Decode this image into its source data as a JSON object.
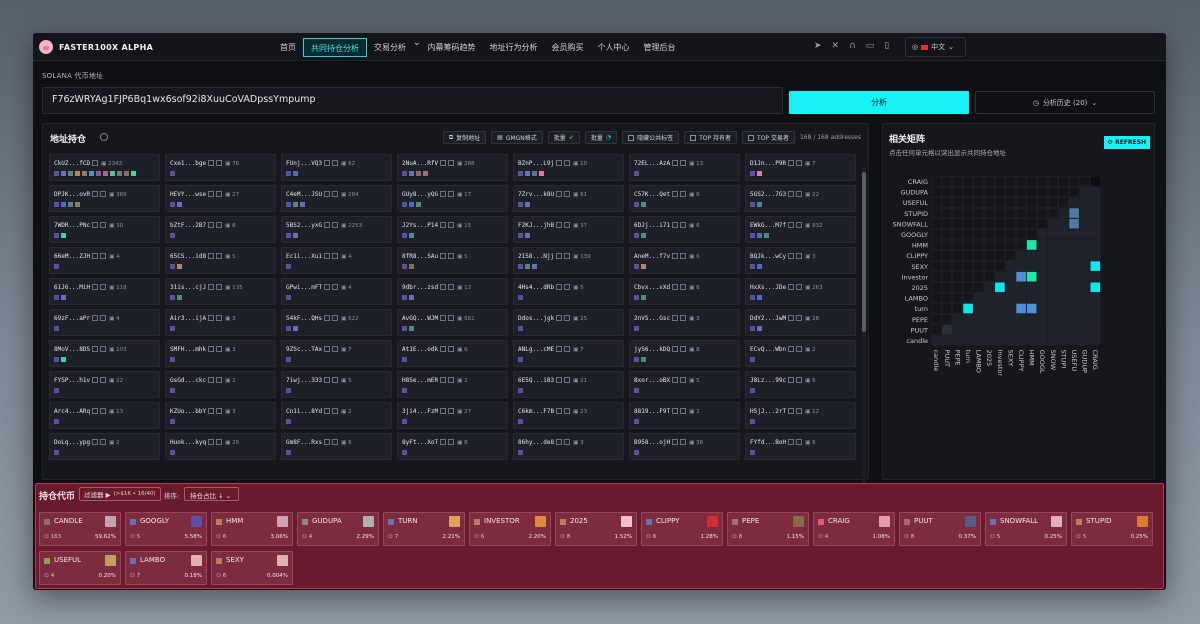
{
  "app": {
    "name": "FASTER100X ALPHA"
  },
  "nav": [
    "首页",
    "共同持仓分析",
    "交易分析",
    "内幕筹码趋势",
    "地址行为分析",
    "会员购买",
    "个人中心",
    "管理后台"
  ],
  "nav_dropdown_index": 2,
  "lang": "中文",
  "address_label": "SOLANA 代币地址",
  "address_value": "F76zWRYAg1FJP6Bq1wx6sof92i8XuuCoVADpssYmpump",
  "analyze_label": "分析",
  "history_label": "分析历史 (20)",
  "holdings": {
    "title": "地址持仓",
    "copy": "复制地址",
    "gmgn": "GMGN格式",
    "batch1": "批量",
    "batch2": "批量",
    "hide_public": "隐藏公共标签",
    "top_holder": "TOP 持有者",
    "top_trader": "TOP 交易者",
    "count": "168 / 168 addresses",
    "cards": [
      {
        "a": "CkUZ...fCD",
        "t": "T",
        "n": "2343",
        "c": [
          "#5a4ea8",
          "#6b6fb5",
          "#4f8a84",
          "#b08a5e",
          "#8a7a6a",
          "#5a8fc0",
          "#8a5a9c",
          "#a86a7a",
          "#4ac88a",
          "#6c7a8a",
          "#8a6a5a",
          "#3ed6a0"
        ]
      },
      {
        "a": "Cxe1...bge",
        "t": "HT",
        "n": "76",
        "c": [
          "#5a4ea8"
        ]
      },
      {
        "a": "FUnj...VQ3",
        "t": "HT",
        "n": "62",
        "c": [
          "#5a4ea8",
          "#4a6fb5"
        ]
      },
      {
        "a": "2NuA...RfV",
        "t": "HT",
        "n": "288",
        "c": [
          "#5a4ea8",
          "#6b6fb5",
          "#8a6a5a",
          "#a86a7a"
        ]
      },
      {
        "a": "BZnP...L9j",
        "t": "HT",
        "n": "10",
        "c": [
          "#5a4ea8",
          "#6b6fb5",
          "#4f7a84",
          "#e07aa0"
        ]
      },
      {
        "a": "72EL...AzA",
        "t": "HT",
        "n": "13",
        "c": [
          "#5a4ea8"
        ]
      },
      {
        "a": "D1Jn...P9R",
        "t": "HT",
        "n": "7",
        "c": [
          "#5a4ea8",
          "#e07aa0"
        ]
      },
      {
        "a": "DPJK...ovR",
        "t": "HT",
        "n": "369",
        "c": [
          "#5a4ea8",
          "#4a6fb5",
          "#4f8a84",
          "#8a7a6a"
        ]
      },
      {
        "a": "HEVY...wse",
        "t": "HT",
        "n": "27",
        "c": [
          "#5a4ea8",
          "#6b6fb5"
        ]
      },
      {
        "a": "C4eM...JSU",
        "t": "HT",
        "n": "284",
        "c": [
          "#5a4ea8",
          "#4f8a84",
          "#6b6fb5"
        ]
      },
      {
        "a": "GUy8...yQG",
        "t": "HT",
        "n": "17",
        "c": [
          "#5a4ea8",
          "#4a6fb5",
          "#4f8a84"
        ]
      },
      {
        "a": "7Zrv...k8U",
        "t": "HT",
        "n": "61",
        "c": [
          "#5a4ea8",
          "#6b6fb5"
        ]
      },
      {
        "a": "C57K...Qet",
        "t": "HT",
        "n": "6",
        "c": [
          "#5a4ea8",
          "#4f8a84"
        ]
      },
      {
        "a": "5GS2...7G3",
        "t": "HT",
        "n": "22",
        "c": [
          "#5a4ea8",
          "#4f8a84"
        ]
      },
      {
        "a": "7WDR...PNc",
        "t": "HT",
        "n": "30",
        "c": [
          "#5a4ea8",
          "#3ed6a0"
        ]
      },
      {
        "a": "bZtF...2B7",
        "t": "HT",
        "n": "8",
        "c": [
          "#5a4ea8"
        ]
      },
      {
        "a": "5BS2...yxG",
        "t": "HT",
        "n": "2253",
        "c": [
          "#5a4ea8",
          "#6b6fb5"
        ]
      },
      {
        "a": "J2Ys...P14",
        "t": "HT",
        "n": "15",
        "c": [
          "#5a4ea8",
          "#4f8a84"
        ]
      },
      {
        "a": "F2KJ...jhB",
        "t": "HT",
        "n": "37",
        "c": [
          "#5a4ea8",
          "#6b6fb5"
        ]
      },
      {
        "a": "6DJj...i71",
        "t": "HT",
        "n": "6",
        "c": [
          "#5a4ea8",
          "#4f8a84"
        ]
      },
      {
        "a": "EWkG...M7f",
        "t": "HT",
        "n": "832",
        "c": [
          "#5a4ea8",
          "#4a6fb5",
          "#4f8a84"
        ]
      },
      {
        "a": "66eM...ZJH",
        "t": "HT",
        "n": "4",
        "c": [
          "#5a4ea8"
        ]
      },
      {
        "a": "65CS...id8",
        "t": "HT",
        "n": "5",
        "c": [
          "#5a4ea8",
          "#b08a5e"
        ]
      },
      {
        "a": "Ec1i...Xu1",
        "t": "HT",
        "n": "4",
        "c": [
          "#5a4ea8"
        ]
      },
      {
        "a": "8fR8...SAu",
        "t": "HT",
        "n": "5",
        "c": [
          "#5a4ea8",
          "#8a6a5a"
        ]
      },
      {
        "a": "2158...Njj",
        "t": "HT",
        "n": "139",
        "c": [
          "#5a4ea8",
          "#4f8a84",
          "#6b6fb5"
        ]
      },
      {
        "a": "AneM...f7v",
        "t": "HT",
        "n": "6",
        "c": [
          "#5a4ea8",
          "#b08a5e"
        ]
      },
      {
        "a": "BQJk...wCy",
        "t": "HT",
        "n": "3",
        "c": [
          "#5a4ea8",
          "#4a6fb5"
        ]
      },
      {
        "a": "61J6...MiH",
        "t": "HT",
        "n": "118",
        "c": [
          "#5a4ea8",
          "#6b6fb5"
        ]
      },
      {
        "a": "31is...cjJ",
        "t": "HT",
        "n": "135",
        "c": [
          "#5a4ea8",
          "#4f8a84"
        ]
      },
      {
        "a": "GPwi...mFT",
        "t": "HT",
        "n": "4",
        "c": [
          "#5a4ea8"
        ]
      },
      {
        "a": "9dbr...zsd",
        "t": "HT",
        "n": "12",
        "c": [
          "#5a4ea8",
          "#6b6fb5"
        ]
      },
      {
        "a": "4Hs4...dRb",
        "t": "HT",
        "n": "5",
        "c": [
          "#5a4ea8"
        ]
      },
      {
        "a": "Cbvx...vXd",
        "t": "HT",
        "n": "6",
        "c": [
          "#5a4ea8",
          "#4f8a84"
        ]
      },
      {
        "a": "HxXs...JDe",
        "t": "HT",
        "n": "263",
        "c": [
          "#5a4ea8",
          "#4a6fb5"
        ]
      },
      {
        "a": "69zF...aPr",
        "t": "HT",
        "n": "4",
        "c": [
          "#5a4ea8"
        ]
      },
      {
        "a": "Air3...ijA",
        "t": "HT",
        "n": "3",
        "c": [
          "#5a4ea8"
        ]
      },
      {
        "a": "54kF...QHs",
        "t": "HT",
        "n": "622",
        "c": [
          "#5a4ea8",
          "#6b6fb5"
        ]
      },
      {
        "a": "AvGQ...WJM",
        "t": "HT",
        "n": "561",
        "c": [
          "#5a4ea8",
          "#4f8a84"
        ]
      },
      {
        "a": "Ddos...jgk",
        "t": "HT",
        "n": "25",
        "c": [
          "#5a4ea8"
        ]
      },
      {
        "a": "2nVS...Gsc",
        "t": "HT",
        "n": "3",
        "c": [
          "#5a4ea8"
        ]
      },
      {
        "a": "DdY2...JwM",
        "t": "HT",
        "n": "28",
        "c": [
          "#5a4ea8",
          "#6b6fb5"
        ]
      },
      {
        "a": "8MoV...8DS",
        "t": "HT",
        "n": "103",
        "c": [
          "#5a4ea8",
          "#3ed6a0"
        ]
      },
      {
        "a": "SMFH...mhk",
        "t": "HT",
        "n": "3",
        "c": [
          "#5a4ea8"
        ]
      },
      {
        "a": "9ZSc...TAx",
        "t": "HT",
        "n": "7",
        "c": [
          "#5a4ea8"
        ]
      },
      {
        "a": "At1E...odk",
        "t": "HT",
        "n": "6",
        "c": [
          "#5a4ea8"
        ]
      },
      {
        "a": "ANLg...cME",
        "t": "HT",
        "n": "7",
        "c": [
          "#5a4ea8"
        ]
      },
      {
        "a": "jyS6...kDQ",
        "t": "HT",
        "n": "8",
        "c": [
          "#5a4ea8",
          "#4f8a84"
        ]
      },
      {
        "a": "ECvQ...Wbn",
        "t": "HT",
        "n": "2",
        "c": [
          "#5a4ea8"
        ]
      },
      {
        "a": "FYSP...h1v",
        "t": "HT",
        "n": "22",
        "c": [
          "#5a4ea8"
        ]
      },
      {
        "a": "GsGd...ckc",
        "t": "HT",
        "n": "2",
        "c": [
          "#5a4ea8"
        ]
      },
      {
        "a": "7iwj...333",
        "t": "HT",
        "n": "5",
        "c": [
          "#5a4ea8"
        ]
      },
      {
        "a": "H8Se...mER",
        "t": "HT",
        "n": "2",
        "c": [
          "#5a4ea8"
        ]
      },
      {
        "a": "6E5Q...i83",
        "t": "HT",
        "n": "21",
        "c": [
          "#5a4ea8"
        ]
      },
      {
        "a": "8xor...oBX",
        "t": "HT",
        "n": "5",
        "c": [
          "#5a4ea8"
        ]
      },
      {
        "a": "J8Lz...99c",
        "t": "HT",
        "n": "6",
        "c": [
          "#5a4ea8"
        ]
      },
      {
        "a": "Arc4...ARq",
        "t": "HT",
        "n": "13",
        "c": [
          "#5a4ea8"
        ]
      },
      {
        "a": "KZUo...bbY",
        "t": "HT",
        "n": "3",
        "c": [
          "#5a4ea8"
        ]
      },
      {
        "a": "Cn1i...8Yd",
        "t": "HT",
        "n": "2",
        "c": [
          "#5a4ea8"
        ]
      },
      {
        "a": "3ji4...FzM",
        "t": "HT",
        "n": "27",
        "c": [
          "#5a4ea8"
        ]
      },
      {
        "a": "C6km...F7B",
        "t": "HT",
        "n": "23",
        "c": [
          "#5a4ea8"
        ]
      },
      {
        "a": "8819...F9T",
        "t": "HT",
        "n": "2",
        "c": [
          "#5a4ea8"
        ]
      },
      {
        "a": "H5jJ...2rT",
        "t": "HT",
        "n": "12",
        "c": [
          "#5a4ea8"
        ]
      },
      {
        "a": "DoLq...ypg",
        "t": "HT",
        "n": "2",
        "c": [
          "#5a4ea8"
        ]
      },
      {
        "a": "Huok...kyq",
        "t": "HT",
        "n": "26",
        "c": [
          "#5a4ea8"
        ]
      },
      {
        "a": "Gm8F...Rxs",
        "t": "HT",
        "n": "6",
        "c": [
          "#5a4ea8"
        ]
      },
      {
        "a": "8yFt...XoT",
        "t": "HT",
        "n": "8",
        "c": [
          "#5a4ea8"
        ]
      },
      {
        "a": "86hy...de8",
        "t": "HT",
        "n": "3",
        "c": [
          "#5a4ea8"
        ]
      },
      {
        "a": "B958...ojH",
        "t": "HT",
        "n": "36",
        "c": [
          "#5a4ea8"
        ]
      },
      {
        "a": "FYfd...BoH",
        "t": "HT",
        "n": "6",
        "c": [
          "#5a4ea8"
        ]
      }
    ]
  },
  "correlation": {
    "title": "相关矩阵",
    "subtitle": "点击任何单元格以突出显示共同持仓地址",
    "refresh": "REFRESH",
    "labels": [
      "CRAIG",
      "GUDUPA",
      "USEFUL",
      "STUPID",
      "SNOWFALL",
      "GOOGLY",
      "HMM",
      "CLIPPY",
      "SEXY",
      "Investor",
      "2025",
      "LAMBO",
      "turn",
      "PEPE",
      "PUUT",
      "candle"
    ],
    "x_labels": [
      "candle",
      "PUUT",
      "PEPE",
      "turn",
      "LAMBO",
      "2025",
      "Investor",
      "SEXY",
      "CLIPPY",
      "HMM",
      "GOOGL",
      "SNOW",
      "STUPI",
      "USEFU",
      "GUDUP",
      "CRAIG"
    ],
    "highlights": [
      {
        "r": 0,
        "c": 15,
        "color": "#0b0d10"
      },
      {
        "r": 3,
        "c": 13,
        "color": "#4e79a7"
      },
      {
        "r": 4,
        "c": 13,
        "color": "#4e79a7"
      },
      {
        "r": 6,
        "c": 9,
        "color": "#23e6a6"
      },
      {
        "r": 8,
        "c": 15,
        "color": "#10e6f0"
      },
      {
        "r": 9,
        "c": 8,
        "color": "#4f8fd8"
      },
      {
        "r": 9,
        "c": 9,
        "color": "#23e6a6"
      },
      {
        "r": 10,
        "c": 6,
        "color": "#10e6f0"
      },
      {
        "r": 10,
        "c": 15,
        "color": "#10e6f0"
      },
      {
        "r": 12,
        "c": 3,
        "color": "#10e6f0"
      },
      {
        "r": 12,
        "c": 8,
        "color": "#4f8fd8"
      },
      {
        "r": 12,
        "c": 9,
        "color": "#4f8fd8"
      },
      {
        "r": 14,
        "c": 1,
        "color": "#2a2e38"
      }
    ]
  },
  "portfolio": {
    "title": "持仓代币",
    "filter": "过滤器 ▶",
    "filter_detail": "(>$1K • 16/40)",
    "sort_label": "排序:",
    "sort_value": "持仓占比 ↓",
    "tokens": [
      {
        "name": "CANDLE",
        "holders": "163",
        "pct": "59.62%",
        "sq": "#8a6a78",
        "img": "#c9a3b0"
      },
      {
        "name": "GOOGLY",
        "holders": "5",
        "pct": "5.58%",
        "sq": "#6b6fb5",
        "img": "#5a4ea8"
      },
      {
        "name": "HMM",
        "holders": "6",
        "pct": "3.06%",
        "sq": "#c07a5a",
        "img": "#d4a0b5"
      },
      {
        "name": "GUDUPA",
        "holders": "4",
        "pct": "2.29%",
        "sq": "#8a8a8a",
        "img": "#b0b0b0"
      },
      {
        "name": "TURN",
        "holders": "7",
        "pct": "2.21%",
        "sq": "#6b6fb5",
        "img": "#e0a060"
      },
      {
        "name": "INVESTOR",
        "holders": "6",
        "pct": "2.20%",
        "sq": "#c07a5a",
        "img": "#e08a40"
      },
      {
        "name": "2025",
        "holders": "8",
        "pct": "1.52%",
        "sq": "#c07a5a",
        "img": "#f0c0d0"
      },
      {
        "name": "CLIPPY",
        "holders": "6",
        "pct": "1.28%",
        "sq": "#6b6fb5",
        "img": "#d03030"
      },
      {
        "name": "PEPE",
        "holders": "8",
        "pct": "1.15%",
        "sq": "#a86a7a",
        "img": "#8a6a4a"
      },
      {
        "name": "CRAIG",
        "holders": "4",
        "pct": "1.08%",
        "sq": "#e05a6a",
        "img": "#e0a0b0"
      },
      {
        "name": "PUUT",
        "holders": "8",
        "pct": "0.37%",
        "sq": "#a86a7a",
        "img": "#5a5a8a"
      },
      {
        "name": "SNOWFALL",
        "holders": "5",
        "pct": "0.25%",
        "sq": "#6b6fb5",
        "img": "#e0b0c0"
      },
      {
        "name": "STUPID",
        "holders": "5",
        "pct": "0.25%",
        "sq": "#c07a5a",
        "img": "#e07a30"
      },
      {
        "name": "USEFUL",
        "holders": "4",
        "pct": "0.20%",
        "sq": "#8aa050",
        "img": "#c0a060"
      },
      {
        "name": "LAMBO",
        "holders": "7",
        "pct": "0.18%",
        "sq": "#6b6fb5",
        "img": "#e0b0b0"
      },
      {
        "name": "SEXY",
        "holders": "6",
        "pct": "0.004%",
        "sq": "#c07a5a",
        "img": "#e0b0b0"
      }
    ]
  }
}
